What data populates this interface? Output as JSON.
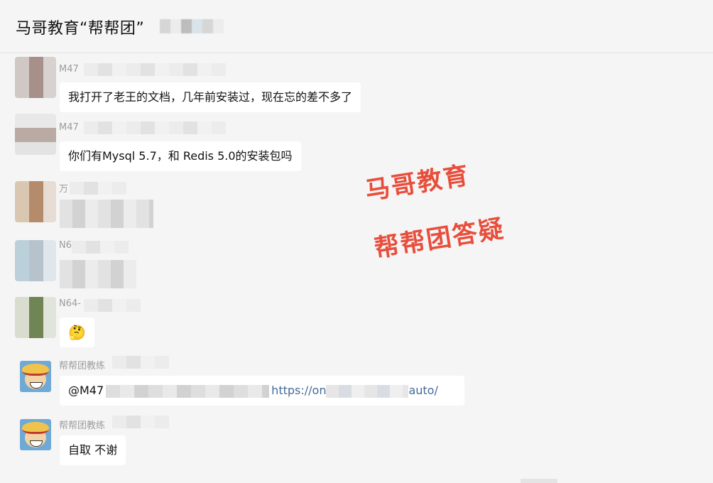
{
  "header": {
    "title": "马哥教育“帮帮团”"
  },
  "messages": [
    {
      "name": "M47",
      "text": "我打开了老王的文档，几年前安装过，现在忘的差不多了"
    },
    {
      "name": "M47",
      "text": "你们有Mysql 5.7，和 Redis  5.0的安装包吗"
    },
    {
      "name": "万",
      "text": ""
    },
    {
      "name": "N6",
      "text": ""
    },
    {
      "name": "N64-",
      "text": "🤔"
    },
    {
      "name": "帮帮团教练",
      "text_prefix": "@M47",
      "link_start": "https://on",
      "link_end": "auto/"
    },
    {
      "name": "帮帮团教练",
      "text": "自取 不谢"
    }
  ],
  "watermark": {
    "line1": "马哥教育",
    "line2": "帮帮团答疑"
  },
  "colors": {
    "watermark": "#e84e3c",
    "background": "#f5f5f5",
    "link": "#456a9a"
  }
}
